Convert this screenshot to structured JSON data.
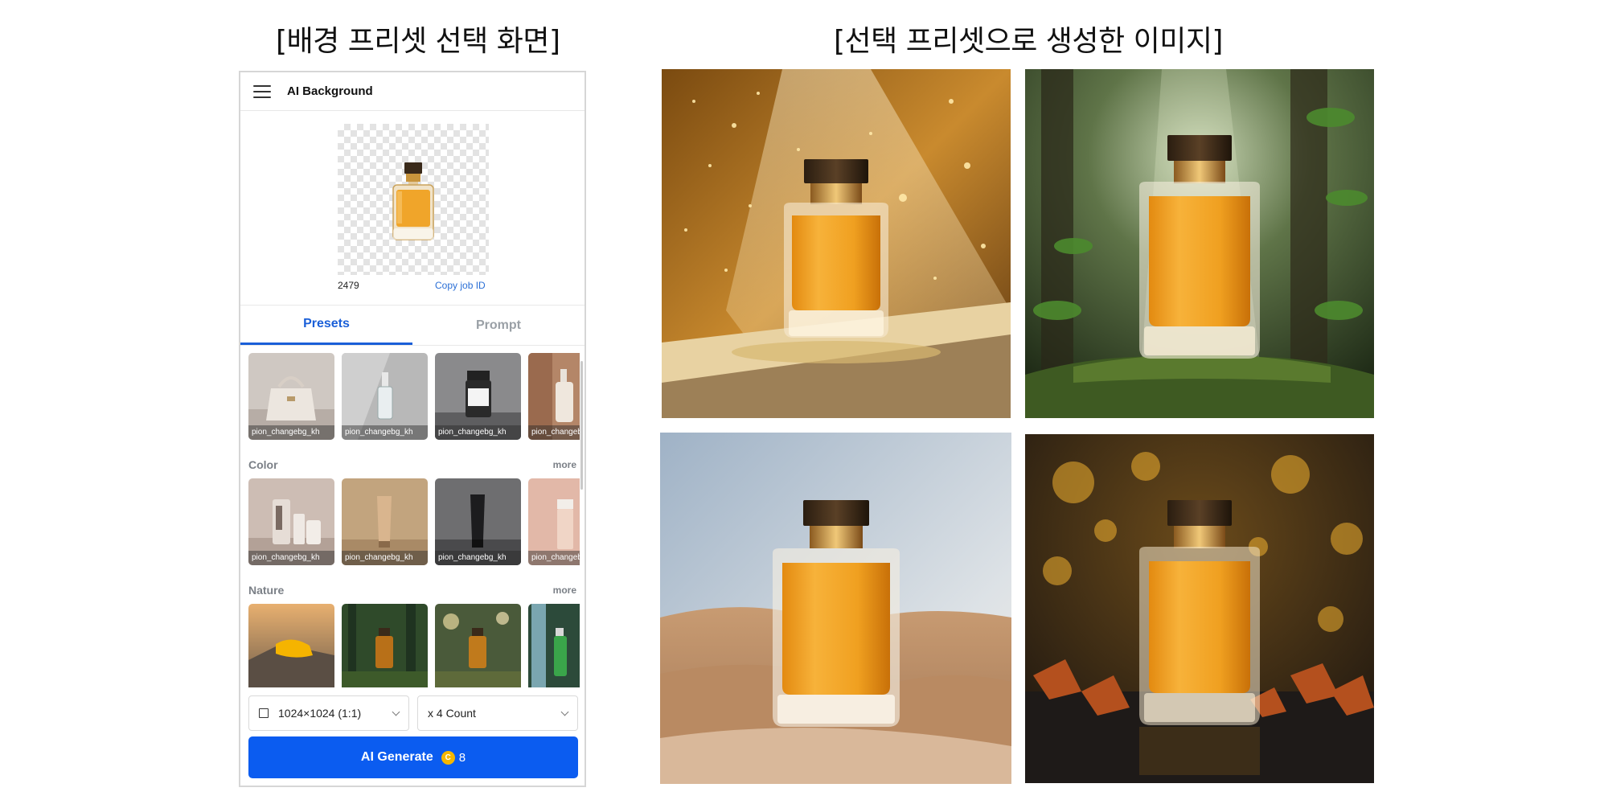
{
  "headings": {
    "left": "[배경 프리셋 선택 화면]",
    "right": "[선택 프리셋으로 생성한 이미지]"
  },
  "app": {
    "menu_icon": "hamburger-menu-icon",
    "title": "AI Background"
  },
  "job": {
    "id": "2479",
    "copy_label": "Copy job ID"
  },
  "tabs": [
    {
      "label": "Presets",
      "active": true
    },
    {
      "label": "Prompt",
      "active": false
    }
  ],
  "presets": {
    "top_row": [
      {
        "caption": "pion_changebg_kh"
      },
      {
        "caption": "pion_changebg_kh"
      },
      {
        "caption": "pion_changebg_kh"
      },
      {
        "caption": "pion_changebg_kh"
      }
    ],
    "sections": [
      {
        "title": "Color",
        "more": "more",
        "items": [
          {
            "caption": "pion_changebg_kh"
          },
          {
            "caption": "pion_changebg_kh"
          },
          {
            "caption": "pion_changebg_kh"
          },
          {
            "caption": "pion_changebg_kh"
          }
        ]
      },
      {
        "title": "Nature",
        "more": "more",
        "items": [
          {
            "caption": ""
          },
          {
            "caption": ""
          },
          {
            "caption": ""
          },
          {
            "caption": ""
          }
        ]
      }
    ]
  },
  "controls": {
    "size_icon": "square-icon",
    "size_value": "1024×1024 (1:1)",
    "count_value": "x 4 Count",
    "generate_label": "AI Generate",
    "coin_icon": "coin-icon",
    "coin_symbol": "C",
    "cost": "8"
  },
  "colors": {
    "accent": "#0b5cf0",
    "tab_active": "#1a5fd8",
    "link": "#2b6fd6",
    "coin": "#f5b700"
  }
}
